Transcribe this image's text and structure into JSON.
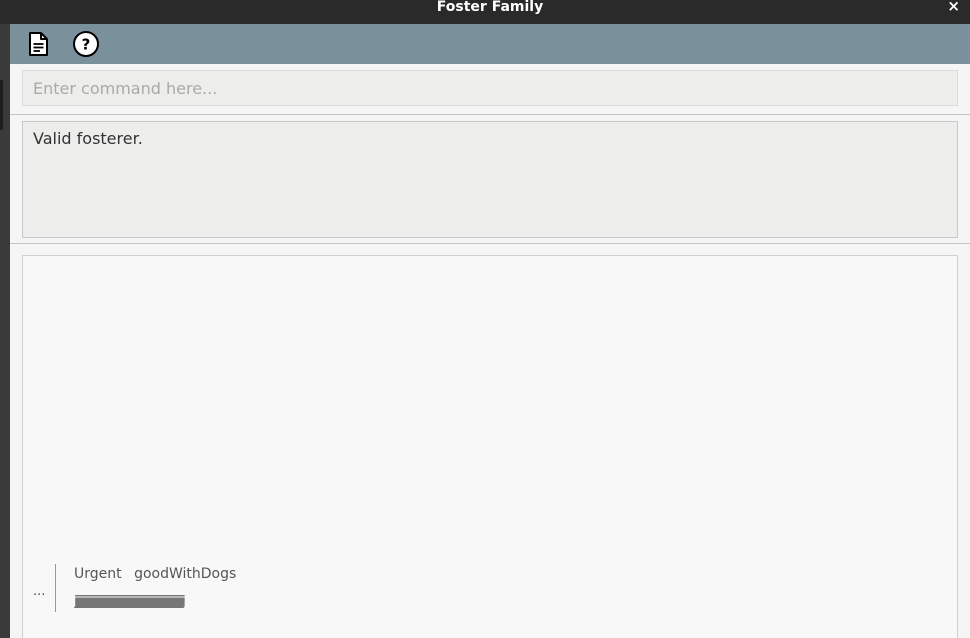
{
  "window": {
    "title": "Foster Family",
    "close_label": "×"
  },
  "menubar": {
    "file_icon": "document-icon",
    "help_icon": "help-icon"
  },
  "command": {
    "value": "",
    "placeholder": "Enter command here..."
  },
  "result": {
    "text": "Valid fosterer."
  },
  "list": {
    "cards": [
      {
        "index": "...",
        "tags": [
          "Urgent",
          "goodWithDogs"
        ],
        "name": "jjjjjjjjjjjjjjjjjjjjjjjjjjjjjjjjjjjjjjjjjjjjjjjjjjjjjjjjjjjjjjjjjjjjjjjjjjjjjjjjjjjjjjjjjjjjjjjjjjjjjjjjjjjjjjjjjjjjjjjjjjjjjjjjjjjjjjjjjjjjjjjjjjjjjjjjjjjjjjjjjjjjjjjjjjjjjjjjjjjjjjjjjjjjjjjjjjjjjjjjjjjjjjjjjjjjjjjjjjjjjjjjjjjjjjjjjjjjjjjjjjjjjjjjjjjjjjjjjjjjjjjj"
      }
    ]
  }
}
